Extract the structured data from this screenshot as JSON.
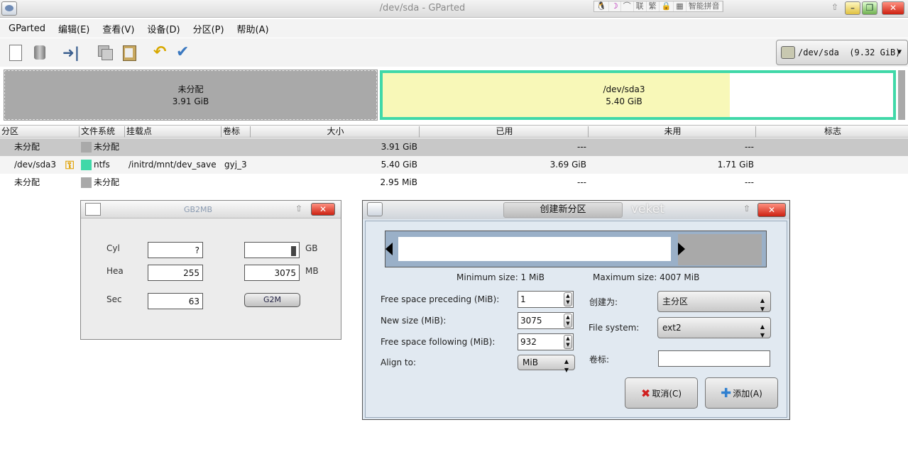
{
  "window": {
    "title": "/dev/sda - GParted",
    "ime": [
      "联",
      "繁",
      "智能拼音"
    ]
  },
  "menu": [
    "GParted",
    "编辑(E)",
    "查看(V)",
    "设备(D)",
    "分区(P)",
    "帮助(A)"
  ],
  "device_selector": {
    "label": "/dev/sda  (9.32 GiB)"
  },
  "disk_graphic": {
    "unallocated": {
      "name": "未分配",
      "size": "3.91 GiB"
    },
    "sda3": {
      "name": "/dev/sda3",
      "size": "5.40 GiB",
      "used_fraction": 0.68
    }
  },
  "table": {
    "headers": [
      "分区",
      "文件系统",
      "挂载点",
      "卷标",
      "大小",
      "已用",
      "未用",
      "标志"
    ],
    "rows": [
      {
        "partition": "未分配",
        "fs": "未分配",
        "fs_color": "#a9a9a9",
        "mount": "",
        "label": "",
        "size": "3.91 GiB",
        "used": "---",
        "unused": "---",
        "flags": ""
      },
      {
        "partition": "/dev/sda3",
        "fs": "ntfs",
        "fs_color": "#40d8a8",
        "mount": "/initrd/mnt/dev_save",
        "label": "gyj_3",
        "size": "5.40 GiB",
        "used": "3.69 GiB",
        "unused": "1.71 GiB",
        "flags": "",
        "key_icon": true
      },
      {
        "partition": "未分配",
        "fs": "未分配",
        "fs_color": "#a9a9a9",
        "mount": "",
        "label": "",
        "size": "2.95 MiB",
        "used": "---",
        "unused": "---",
        "flags": ""
      }
    ]
  },
  "gb2mb": {
    "title": "GB2MB",
    "labels": {
      "cyl": "Cyl",
      "hea": "Hea",
      "sec": "Sec",
      "gb": "GB",
      "mb": "MB"
    },
    "values": {
      "cyl": "?",
      "hea": "255",
      "sec": "63",
      "gb": "",
      "mb": "3075"
    },
    "button": "G2M"
  },
  "create_partition": {
    "title": "创建新分区",
    "watermark": "veket",
    "min_size": "Minimum size: 1 MiB",
    "max_size": "Maximum size: 4007 MiB",
    "labels": {
      "preceding": "Free space preceding (MiB):",
      "new_size": "New size (MiB):",
      "following": "Free space following (MiB):",
      "align": "Align to:",
      "create_as": "创建为:",
      "fs": "File system:",
      "label": "卷标:"
    },
    "values": {
      "preceding": "1",
      "new_size": "3075",
      "following": "932",
      "align": "MiB",
      "create_as": "主分区",
      "fs": "ext2",
      "label": ""
    },
    "cancel": "取消(C)",
    "add": "添加(A)"
  }
}
